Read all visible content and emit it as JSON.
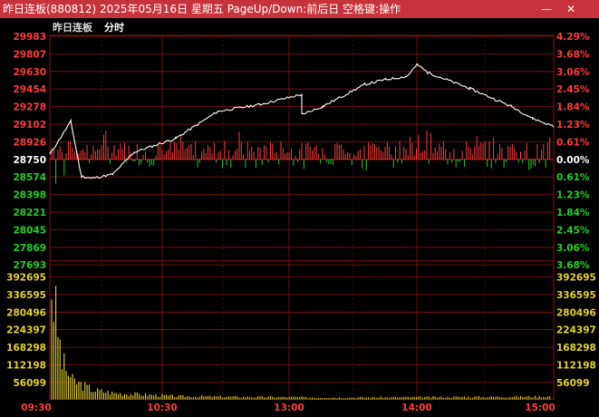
{
  "window": {
    "title": "昨日连板(880812) 2025年05月16日 星期五 PageUp/Down:前后日 空格键:操作",
    "minimize_icon": "minimize-icon",
    "close_icon": "close-icon"
  },
  "tabs": [
    {
      "label": "昨日连板"
    },
    {
      "label": "分时"
    }
  ],
  "colors": {
    "up": "#ff3b3b",
    "down": "#22d022",
    "flat": "#ffffff",
    "volume": "#e6d22a",
    "grid": "#8a1010",
    "price_line": "#ffffff",
    "titlebar": "#c8323a"
  },
  "price_axis": {
    "left_labels": [
      "29983",
      "29807",
      "29630",
      "29454",
      "29278",
      "29102",
      "28926",
      "28750",
      "28574",
      "28398",
      "28221",
      "28045",
      "27869",
      "27693"
    ],
    "right_labels": [
      "4.29%",
      "3.68%",
      "3.06%",
      "2.45%",
      "1.84%",
      "1.23%",
      "0.61%",
      "0.00%",
      "0.61%",
      "1.23%",
      "1.84%",
      "2.45%",
      "3.06%",
      "3.68%"
    ],
    "baseline_index": 7
  },
  "volume_axis": {
    "labels": [
      "392695",
      "336595",
      "280496",
      "224397",
      "168298",
      "112198",
      "56099"
    ]
  },
  "time_axis": {
    "labels": [
      "09:30",
      "10:30",
      "13:00",
      "14:00",
      "15:00"
    ]
  },
  "chart_data": {
    "type": "line",
    "x": [
      "09:30",
      "09:40",
      "09:45",
      "09:50",
      "10:00",
      "10:10",
      "10:30",
      "10:50",
      "11:10",
      "11:30",
      "13:00",
      "13:10",
      "13:30",
      "13:40",
      "13:50",
      "13:55",
      "14:00",
      "14:10",
      "14:20",
      "14:40",
      "14:50",
      "15:00"
    ],
    "series": [
      {
        "values": [
          28800,
          29130,
          28580,
          28560,
          28600,
          28820,
          28960,
          29230,
          29300,
          29400,
          29200,
          29280,
          29500,
          29550,
          29580,
          29700,
          29620,
          29540,
          29460,
          29280,
          29160,
          29080
        ]
      }
    ],
    "volume": {
      "x": [
        "09:30",
        "09:35",
        "09:40",
        "09:50",
        "10:00",
        "10:30",
        "11:00",
        "11:30",
        "13:00",
        "13:30",
        "14:00",
        "14:30",
        "15:00"
      ],
      "values": [
        370000,
        120000,
        60000,
        30000,
        20000,
        10000,
        8000,
        7000,
        6000,
        6000,
        7000,
        8000,
        9000
      ]
    },
    "ylim": [
      27517,
      30159
    ],
    "ylabel_right": "",
    "xlabel": ""
  }
}
